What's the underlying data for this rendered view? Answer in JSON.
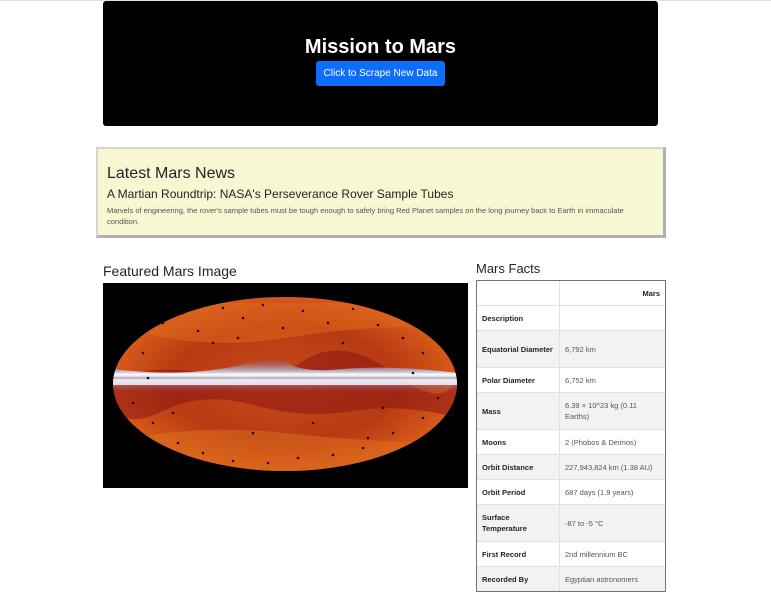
{
  "header": {
    "title": "Mission to Mars",
    "scrape_button": "Click to Scrape New Data"
  },
  "news": {
    "section_title": "Latest Mars News",
    "headline": "A Martian Roundtrip: NASA's Perseverance Rover Sample Tubes",
    "teaser": "Marvels of engineering, the rover's sample tubes must be tough enough to safely bring Red Planet samples on the long journey back to Earth in immaculate condition."
  },
  "featured_image": {
    "title": "Featured Mars Image"
  },
  "facts": {
    "title": "Mars Facts",
    "header": [
      "",
      "Mars"
    ],
    "rows": [
      {
        "label": "Description",
        "value": ""
      },
      {
        "label": "Equatorial Diameter",
        "value": "6,792 km"
      },
      {
        "label": "Polar Diameter",
        "value": "6,752 km"
      },
      {
        "label": "Mass",
        "value": "6.39 × 10^23 kg (0.11 Earths)"
      },
      {
        "label": "Moons",
        "value": "2 (Phobos & Deimos)"
      },
      {
        "label": "Orbit Distance",
        "value": "227,943,824 km (1.38 AU)"
      },
      {
        "label": "Orbit Period",
        "value": "687 days (1.9 years)"
      },
      {
        "label": "Surface Temperature",
        "value": "-87 to -5 °C"
      },
      {
        "label": "First Record",
        "value": "2nd millennium BC"
      },
      {
        "label": "Recorded By",
        "value": "Egyptian astronomers"
      }
    ]
  },
  "colors": {
    "jumbotron_bg": "#000000",
    "button_bg": "#0d6efd",
    "news_bg": "#f7f7d2"
  }
}
